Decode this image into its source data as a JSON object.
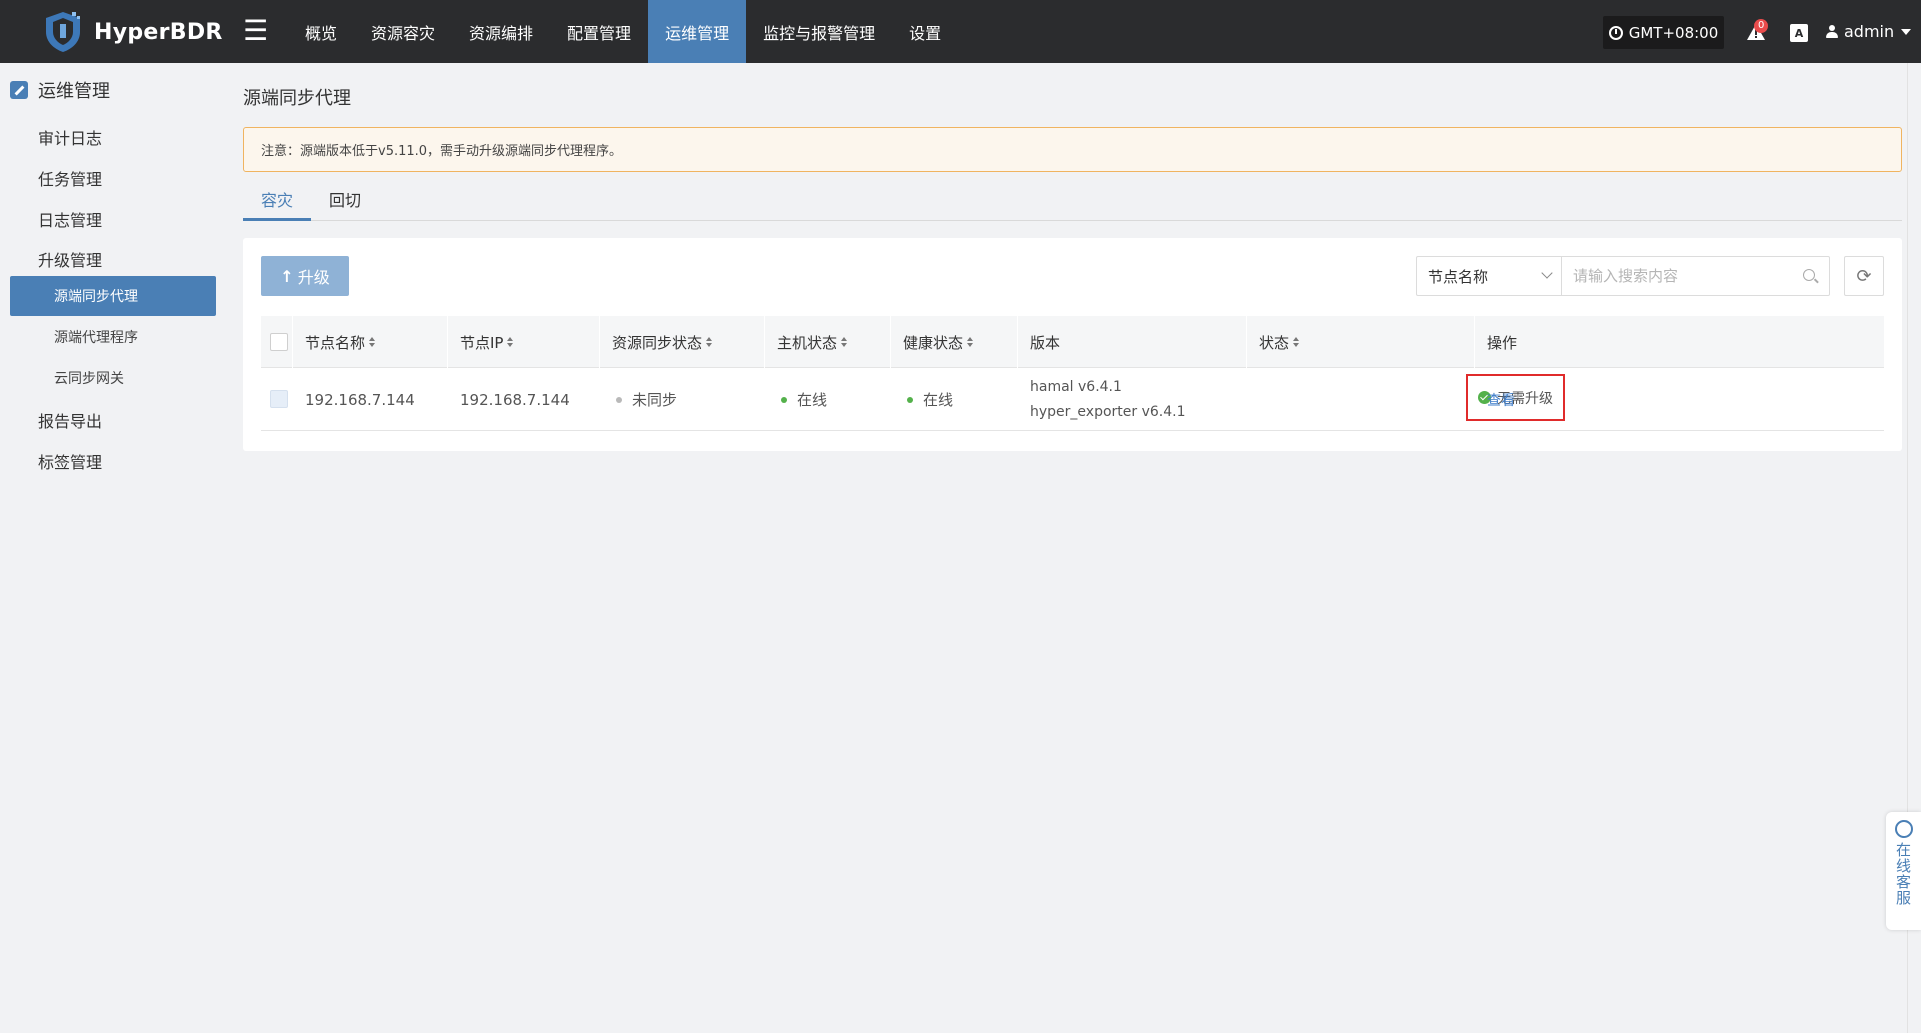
{
  "app": {
    "name": "HyperBDR"
  },
  "topnav": {
    "menu_icon": "hamburger-icon",
    "items": [
      "概览",
      "资源容灾",
      "资源编排",
      "配置管理",
      "运维管理",
      "监控与报警管理",
      "设置"
    ],
    "active_index": 4,
    "timezone": "GMT+08:00",
    "alert_count": "0",
    "lang_icon": "A",
    "user": "admin"
  },
  "sidebar": {
    "section": "运维管理",
    "items": [
      "审计日志",
      "任务管理",
      "日志管理",
      "升级管理"
    ],
    "sub_items": [
      "源端同步代理",
      "源端代理程序",
      "云同步网关"
    ],
    "items_after": [
      "报告导出",
      "标签管理"
    ],
    "active_sub_index": 0
  },
  "page": {
    "title": "源端同步代理",
    "notice": "注意：源端版本低于v5.11.0，需手动升级源端同步代理程序。",
    "tabs": [
      "容灾",
      "回切"
    ],
    "active_tab": 0
  },
  "toolbar": {
    "upgrade_label": "升级",
    "filter_select": "节点名称",
    "search_placeholder": "请输入搜索内容"
  },
  "table": {
    "columns": [
      "节点名称",
      "节点IP",
      "资源同步状态",
      "主机状态",
      "健康状态",
      "版本",
      "状态",
      "操作"
    ],
    "rows": [
      {
        "node_name": "192.168.7.144",
        "node_ip": "192.168.7.144",
        "sync_status": "未同步",
        "host_status": "在线",
        "health_status": "在线",
        "version_1": "hamal v6.4.1",
        "version_2": "hyper_exporter v6.4.1",
        "status": "无需升级",
        "action": "查看"
      }
    ]
  },
  "floating": {
    "service_label": "在线客服"
  },
  "colors": {
    "topbar": "#2b2c2e",
    "accent": "#4a7fb5",
    "online": "#54b14b",
    "highlight_border": "#e02b2b",
    "notice_border": "#f0b460"
  }
}
